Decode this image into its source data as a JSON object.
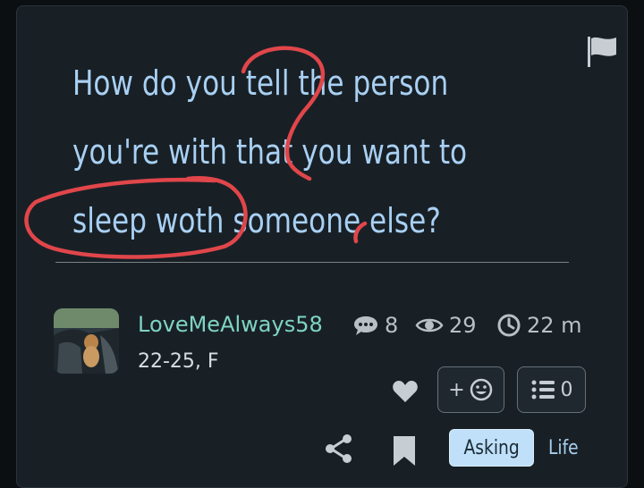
{
  "question": {
    "lines": [
      "How do you tell the person",
      "you're with that you want to",
      "sleep woth someone else?"
    ]
  },
  "author": {
    "name": "LoveMeAlways58",
    "info": "22-25, F"
  },
  "stats": {
    "comments": "8",
    "views": "29",
    "time": "22 m"
  },
  "actions": {
    "react_label": "+",
    "opinions_count": "0"
  },
  "tags": [
    "Asking",
    "Life"
  ],
  "colors": {
    "background": "#0c0f12",
    "card": "#182026",
    "title": "#a9d0f3",
    "username": "#7fd4c4",
    "annotation": "#e0464a"
  },
  "icons": {
    "flag": "flag-icon",
    "comments": "speech-bubble-icon",
    "views": "eye-icon",
    "time": "clock-icon",
    "like": "heart-icon",
    "react": "smiley-icon",
    "opinions": "list-icon",
    "share": "share-icon",
    "save": "bookmark-icon"
  }
}
